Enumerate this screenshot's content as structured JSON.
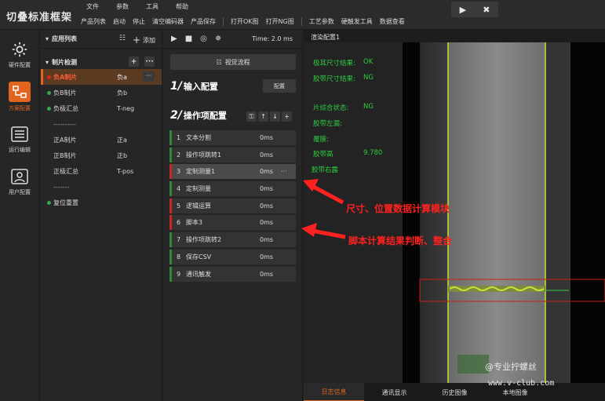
{
  "app_title": "切叠标准框架",
  "menu_top": [
    "文件",
    "参数",
    "工具",
    "帮助"
  ],
  "menu_sub_group1": [
    "产品列表",
    "启动",
    "停止",
    "清空编码器",
    "产品保存"
  ],
  "menu_sub_group2": [
    "打开OK图",
    "打开NG图"
  ],
  "menu_sub_group3": [
    "工艺参数",
    "硬触发工具",
    "数据查看"
  ],
  "sidebar": [
    {
      "label": "硬件配置",
      "icon": "gear-icon"
    },
    {
      "label": "方案配置",
      "icon": "flow-icon",
      "active": true
    },
    {
      "label": "运行编辑",
      "icon": "list-icon"
    },
    {
      "label": "用户配置",
      "icon": "user-icon"
    }
  ],
  "app_list": {
    "title": "应用列表",
    "add_label": "添加",
    "group_title": "制片检测",
    "rows": [
      {
        "name": "负A制片",
        "val": "负a",
        "selected": true,
        "dot": "red"
      },
      {
        "name": "负B制片",
        "val": "负b",
        "dot": "green"
      },
      {
        "name": "负极汇总",
        "val": "T-neg",
        "dot": "green"
      },
      {
        "name": "----------",
        "val": ""
      },
      {
        "name": "正A制片",
        "val": "正a"
      },
      {
        "name": "正B制片",
        "val": "正b"
      },
      {
        "name": "正极汇总",
        "val": "T-pos"
      },
      {
        "name": "-------",
        "val": ""
      },
      {
        "name": "复位重置",
        "val": "",
        "dot": "green"
      }
    ]
  },
  "ops": {
    "time_label": "Time: 2.0 ms",
    "flow_button": "视觉流程",
    "input_section": "输入配置",
    "input_num": "1/",
    "config_button": "配置",
    "op_section": "操作项配置",
    "op_num": "2/",
    "items": [
      {
        "idx": "1",
        "name": "文本分割",
        "ms": "0ms",
        "color": "green"
      },
      {
        "idx": "2",
        "name": "操作项跳转1",
        "ms": "0ms",
        "color": "green"
      },
      {
        "idx": "3",
        "name": "定制测量1",
        "ms": "0ms",
        "color": "red",
        "selected": true,
        "more": "···"
      },
      {
        "idx": "4",
        "name": "定制测量",
        "ms": "0ms",
        "color": "green"
      },
      {
        "idx": "5",
        "name": "逻辑运算",
        "ms": "0ms",
        "color": "red"
      },
      {
        "idx": "6",
        "name": "脚本3",
        "ms": "0ms",
        "color": "red"
      },
      {
        "idx": "7",
        "name": "操作项跳转2",
        "ms": "0ms",
        "color": "green"
      },
      {
        "idx": "8",
        "name": "保存CSV",
        "ms": "0ms",
        "color": "green"
      },
      {
        "idx": "9",
        "name": "通讯触发",
        "ms": "0ms",
        "color": "green"
      }
    ]
  },
  "image_panel": {
    "title": "渲染配置1",
    "results": [
      {
        "label": "极耳尺寸结果:",
        "value": "OK"
      },
      {
        "label": "胶带尺寸结果:",
        "value": "NG"
      },
      {
        "label": "片综合状态:",
        "value": "NG"
      },
      {
        "label": "胶带左漏:",
        "value": ""
      },
      {
        "label": "覆膜:",
        "value": ""
      },
      {
        "label": "胶带高",
        "value": "9.780"
      },
      {
        "label": "胶带右露",
        "value": ""
      }
    ],
    "tabs": [
      "日志信息",
      "通讯显示",
      "历史图像",
      "本地图像"
    ]
  },
  "annotations": {
    "arrow1_text": "尺寸、位置数据计算模块",
    "arrow2_text": "脚本计算结果判断、整合"
  },
  "watermark": {
    "line1": "@专业拧螺丝",
    "line2": "www.v-club.com"
  },
  "colors": {
    "accent": "#e0661f",
    "ok_green": "#2ecc40",
    "annotation_red": "#ff2020"
  }
}
